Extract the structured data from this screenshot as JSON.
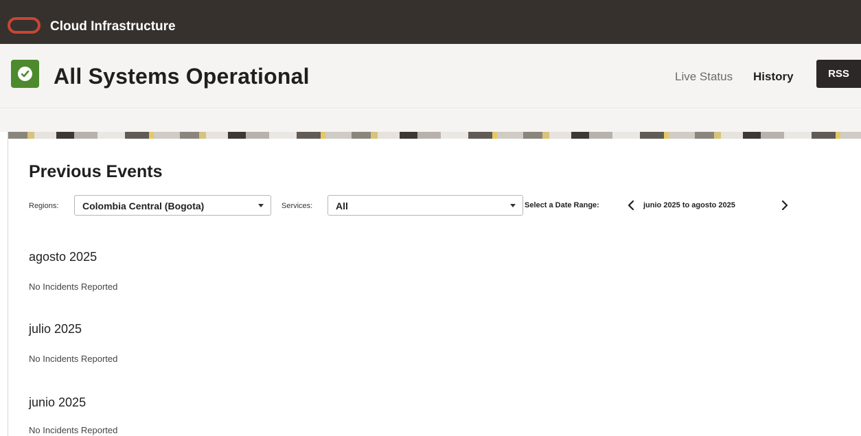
{
  "app": {
    "brand": "Cloud Infrastructure"
  },
  "status": {
    "title": "All Systems Operational",
    "color": "#4d8a2d",
    "nav": {
      "live_status": "Live Status",
      "history": "History",
      "rss": "RSS"
    }
  },
  "events": {
    "title": "Previous Events",
    "filters": {
      "regions_label": "Regions:",
      "regions_value": "Colombia Central (Bogota)",
      "services_label": "Services:",
      "services_value": "All",
      "date_label": "Select a Date Range:",
      "date_range": "junio 2025 to agosto 2025"
    },
    "months": [
      {
        "name": "agosto 2025",
        "status": "No Incidents Reported"
      },
      {
        "name": "julio 2025",
        "status": "No Incidents Reported"
      },
      {
        "name": "junio 2025",
        "status": "No Incidents Reported"
      }
    ]
  },
  "icons": {
    "logo": "oracle-logo-icon",
    "status": "check-circle-icon",
    "prev": "chevron-left-icon",
    "next": "chevron-right-icon",
    "dropdown": "caret-down-icon"
  },
  "colors": {
    "header_bg": "#36312d",
    "brand_red": "#c74634",
    "rss_bg": "#2b2827"
  }
}
